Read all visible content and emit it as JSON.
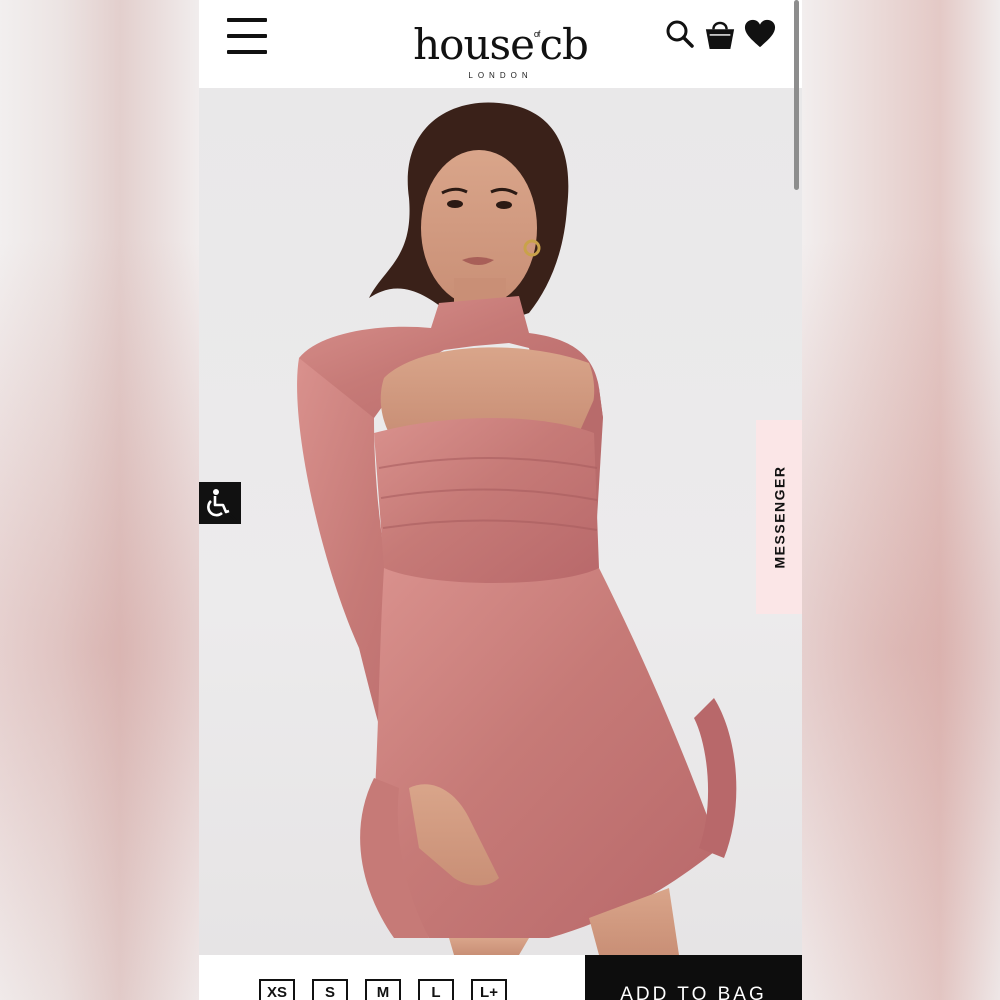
{
  "header": {
    "menu_icon": "hamburger-icon",
    "logo_main": "house",
    "logo_of": "of",
    "logo_cb": "cb",
    "logo_sub": "LONDON",
    "icons": [
      "search-icon",
      "shopping-bag-icon",
      "heart-icon"
    ]
  },
  "hero": {
    "image_description_icon": "model-photo",
    "accent": "#c97f7c"
  },
  "accessibility": {
    "icon": "accessibility-icon"
  },
  "messenger": {
    "label": "MESSENGER"
  },
  "sizes": [
    "XS",
    "S",
    "M",
    "L",
    "L+"
  ],
  "cta": {
    "label": "ADD TO BAG"
  },
  "colors": {
    "header_bg": "#ffffff",
    "cta_bg": "#0d0d0d",
    "messenger_bg": "#fbe6e7",
    "dress": "#c97f7c"
  }
}
